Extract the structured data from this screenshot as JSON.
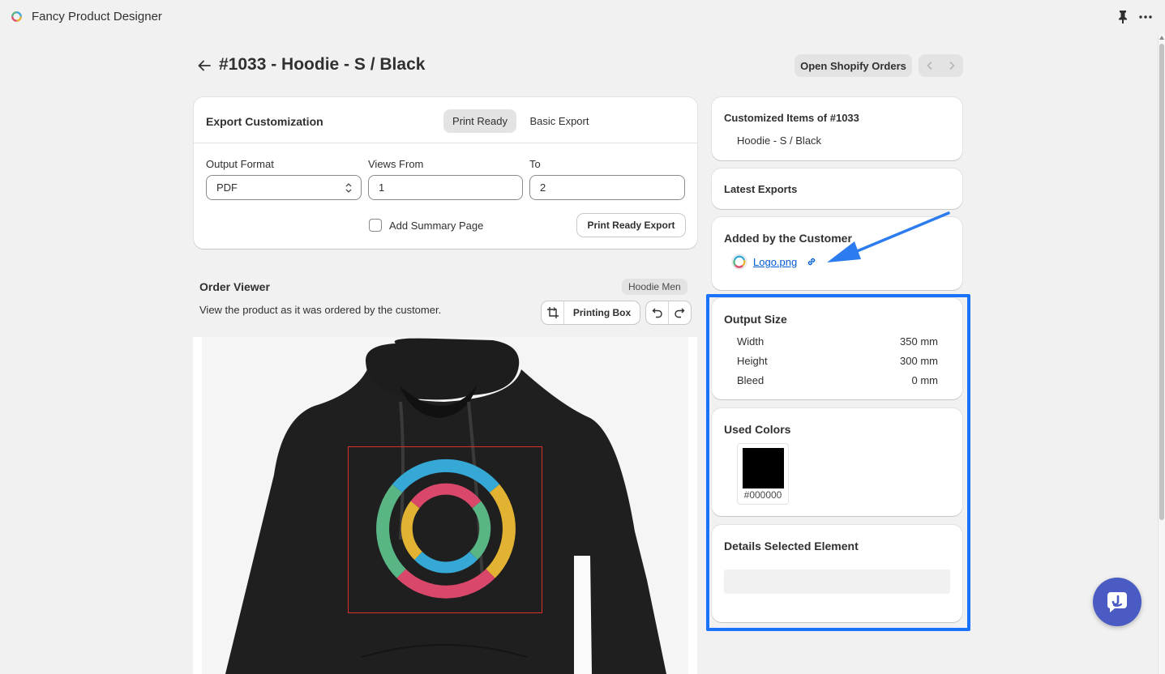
{
  "app": {
    "title": "Fancy Product Designer"
  },
  "header": {
    "title": "#1033 - Hoodie - S / Black",
    "open_orders_label": "Open Shopify Orders"
  },
  "export": {
    "title": "Export Customization",
    "tabs": [
      {
        "label": "Print Ready",
        "selected": true
      },
      {
        "label": "Basic Export",
        "selected": false
      }
    ],
    "output_format_label": "Output Format",
    "output_format_value": "PDF",
    "views_from_label": "Views From",
    "views_from_value": "1",
    "to_label": "To",
    "to_value": "2",
    "summary_label": "Add Summary Page",
    "summary_checked": false,
    "export_button": "Print Ready Export"
  },
  "order_viewer": {
    "title": "Order Viewer",
    "badge": "Hoodie Men",
    "description": "View the product as it was ordered by the customer.",
    "printing_box_label": "Printing Box"
  },
  "customized_items": {
    "title": "Customized Items of #1033",
    "items": [
      "Hoodie - S / Black"
    ]
  },
  "latest_exports": {
    "title": "Latest Exports"
  },
  "added_by_customer": {
    "title": "Added by the Customer",
    "file": "Logo.png"
  },
  "output_size": {
    "title": "Output Size",
    "rows": [
      {
        "label": "Width",
        "value": "350 mm"
      },
      {
        "label": "Height",
        "value": "300 mm"
      },
      {
        "label": "Bleed",
        "value": "0 mm"
      }
    ]
  },
  "used_colors": {
    "title": "Used Colors",
    "colors": [
      {
        "hex": "#000000",
        "label": "#000000"
      }
    ]
  },
  "details": {
    "title": "Details Selected Element"
  },
  "colors": {
    "accent": "#005bd3",
    "highlight": "#1a73ff",
    "fab": "#4a5bc4",
    "print_box": "#d9302c"
  }
}
